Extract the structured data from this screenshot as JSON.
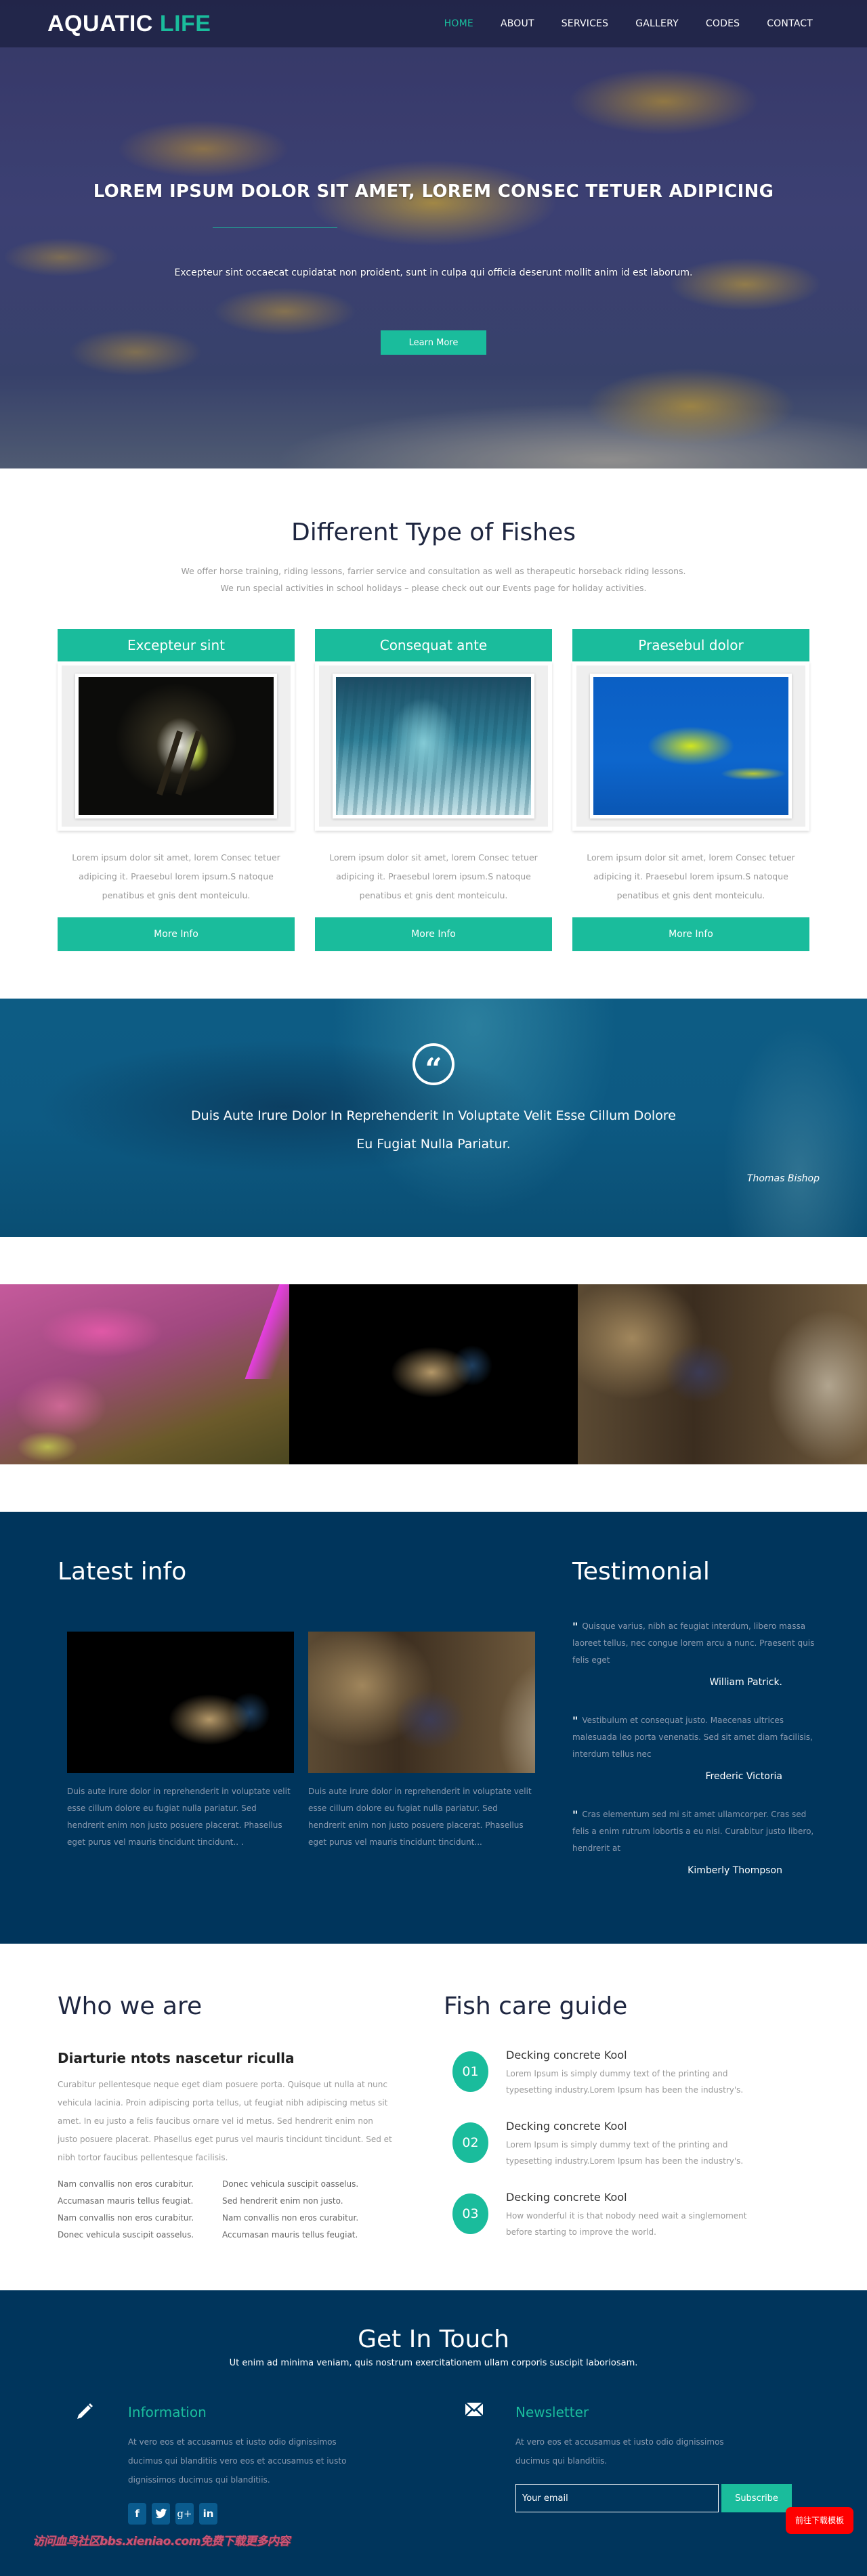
{
  "nav": {
    "logo_main": "AQUATIC",
    "logo_accent": "LIFE",
    "links": [
      "HOME",
      "ABOUT",
      "SERVICES",
      "GALLERY",
      "CODES",
      "CONTACT"
    ],
    "active_index": 0
  },
  "hero": {
    "title": "LOREM IPSUM DOLOR SIT AMET, LOREM CONSEC TETUER ADIPICING",
    "subtitle": "Excepteur sint occaecat cupidatat non proident, sunt in culpa qui officia deserunt mollit anim id est laborum.",
    "button": "Learn More"
  },
  "types": {
    "title": "Different Type of Fishes",
    "intro": "We offer horse training, riding lessons, farrier service and consultation as well as therapeutic horseback riding lessons. We run special activities in school holidays – please check out our Events page for holiday activities.",
    "cards": [
      {
        "title": "Excepteur sint",
        "text": "Lorem ipsum dolor sit amet, lorem Consec tetuer adipicing it. Praesebul lorem ipsum.S natoque penatibus et gnis dent monteiculu.",
        "button": "More Info"
      },
      {
        "title": "Consequat ante",
        "text": "Lorem ipsum dolor sit amet, lorem Consec tetuer adipicing it. Praesebul lorem ipsum.S natoque penatibus et gnis dent monteiculu.",
        "button": "More Info"
      },
      {
        "title": "Praesebul dolor",
        "text": "Lorem ipsum dolor sit amet, lorem Consec tetuer adipicing it. Praesebul lorem ipsum.S natoque penatibus et gnis dent monteiculu.",
        "button": "More Info"
      }
    ]
  },
  "quote": {
    "icon": "“",
    "text": "Duis Aute Irure Dolor In Reprehenderit In Voluptate Velit Esse Cillum Dolore Eu Fugiat Nulla Pariatur.",
    "author": "Thomas Bishop"
  },
  "latest": {
    "title": "Latest info",
    "items": [
      {
        "text": "Duis aute irure dolor in reprehenderit in voluptate velit esse cillum dolore eu fugiat nulla pariatur. Sed hendrerit enim non justo posuere placerat. Phasellus eget purus vel mauris tincidunt tincidunt.. ."
      },
      {
        "text": "Duis aute irure dolor in reprehenderit in voluptate velit esse cillum dolore eu fugiat nulla pariatur. Sed hendrerit enim non justo posuere placerat. Phasellus eget purus vel mauris tincidunt tincidunt..."
      }
    ]
  },
  "testimonial": {
    "title": "Testimonial",
    "quote_mark": "\"",
    "items": [
      {
        "text": "Quisque varius, nibh ac feugiat interdum, libero massa laoreet tellus, nec congue lorem arcu a nunc. Praesent quis felis eget",
        "name": "William Patrick."
      },
      {
        "text": "Vestibulum et consequat justo. Maecenas ultrices malesuada leo porta venenatis. Sed sit amet diam facilisis, interdum tellus nec",
        "name": "Frederic Victoria"
      },
      {
        "text": "Cras elementum sed mi sit amet ullamcorper. Cras sed felis a enim rutrum lobortis a eu nisi. Curabitur justo libero, hendrerit at",
        "name": "Kimberly Thompson"
      }
    ]
  },
  "who": {
    "title": "Who we are",
    "subtitle": "Diarturie ntots nascetur riculla",
    "text": "Curabitur pellentesque neque eget diam posuere porta. Quisque ut nulla at nunc vehicula lacinia. Proin adipiscing porta tellus, ut feugiat nibh adipiscing metus sit amet. In eu justo a felis faucibus ornare vel id metus. Sed hendrerit enim non justo posuere placerat. Phasellus eget purus vel mauris tincidunt tincidunt. Sed et nibh tortor faucibus pellentesque facilisis.",
    "list_left": [
      "Nam convallis non eros curabitur.",
      "Accumasan mauris tellus feugiat.",
      "Nam convallis non eros curabitur.",
      "Donec vehicula suscipit oasselus."
    ],
    "list_right": [
      "Donec vehicula suscipit oasselus.",
      "Sed hendrerit enim non justo.",
      "Nam convallis non eros curabitur.",
      "Accumasan mauris tellus feugiat."
    ]
  },
  "care": {
    "title": "Fish care guide",
    "steps": [
      {
        "num": "01",
        "title": "Decking concrete Kool",
        "text": "Lorem Ipsum is simply dummy text of the printing and typesetting industry.Lorem Ipsum has been the industry's."
      },
      {
        "num": "02",
        "title": "Decking concrete Kool",
        "text": "Lorem Ipsum is simply dummy text of the printing and typesetting industry.Lorem Ipsum has been the industry's."
      },
      {
        "num": "03",
        "title": "Decking concrete Kool",
        "text": "How wonderful it is that nobody need wait a singlemoment before starting to improve the world."
      }
    ]
  },
  "contact": {
    "title": "Get In Touch",
    "subtitle": "Ut enim ad minima veniam, quis nostrum exercitationem ullam corporis suscipit laboriosam.",
    "info_title": "Information",
    "info_text": "At vero eos et accusamus et iusto odio dignissimos ducimus qui blanditiis vero eos et accusamus et iusto dignissimos ducimus qui blanditiis.",
    "socials": [
      "f",
      "t",
      "g+",
      "in"
    ],
    "newsletter_title": "Newsletter",
    "newsletter_text": "At vero eos et accusamus et iusto odio dignissimos ducimus qui blanditiis.",
    "email_placeholder": "Your email",
    "subscribe_label": "Subscribe",
    "watermark": "访问血鸟社区bbs.xieniao.com免费下载更多内容",
    "download_badge": "前往下载模板"
  },
  "colors": {
    "accent": "#1abc9c",
    "navy": "#00355c",
    "heading": "#1e2640",
    "badge_red": "#ff0000"
  }
}
